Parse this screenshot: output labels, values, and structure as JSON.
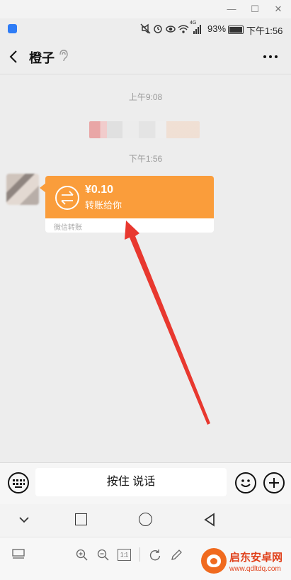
{
  "window": {
    "minimize": "—",
    "maximize": "☐",
    "close": "✕"
  },
  "status_bar": {
    "battery": "93%",
    "time": "下午1:56",
    "network": "4G"
  },
  "chat": {
    "contact_name": "橙子",
    "messages": [
      {
        "type": "time",
        "text": "上午9:08"
      },
      {
        "type": "time",
        "text": "下午1:56"
      }
    ],
    "transfer": {
      "amount": "¥0.10",
      "caption": "转账给你",
      "footer": "微信转账"
    }
  },
  "input": {
    "voice_label": "按住 说话"
  },
  "bottom_toolbar": {
    "zoom_reset": "1:1"
  },
  "watermark": {
    "brand": "启东安卓网",
    "url": "www.qdltdq.com"
  },
  "colors": {
    "transfer_orange": "#fa9d3b",
    "arrow_red": "#e8382f",
    "background": "#ededed"
  }
}
